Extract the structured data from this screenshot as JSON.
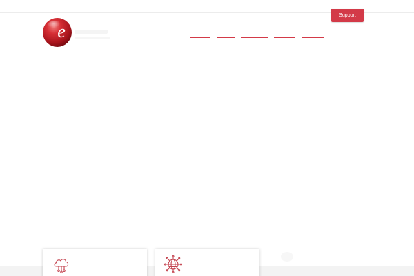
{
  "header": {
    "support_label": "Support"
  },
  "logo": {
    "letter": "e"
  },
  "nav": {
    "items": [
      {
        "name": "nav-item-1"
      },
      {
        "name": "nav-item-2"
      },
      {
        "name": "nav-item-3"
      },
      {
        "name": "nav-item-4"
      },
      {
        "name": "nav-item-5"
      }
    ]
  },
  "cards": [
    {
      "icon": "cloud-network-icon"
    },
    {
      "icon": "globe-network-icon"
    }
  ],
  "colors": {
    "brand_red": "#d33a48",
    "icon_stroke": "#c4434f",
    "band_gray": "#f3f3f3"
  }
}
